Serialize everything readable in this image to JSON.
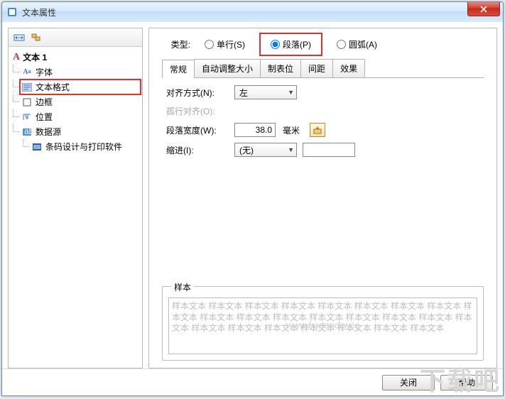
{
  "window": {
    "title": "文本属性"
  },
  "tree": {
    "root": "文本 1",
    "items": [
      {
        "icon": "font-icon",
        "label": "字体"
      },
      {
        "icon": "format-icon",
        "label": "文本格式",
        "highlight": true
      },
      {
        "icon": "border-icon",
        "label": "边框"
      },
      {
        "icon": "position-icon",
        "label": "位置"
      },
      {
        "icon": "datasource-icon",
        "label": "数据源"
      }
    ],
    "subitem": "条码设计与打印软件"
  },
  "type": {
    "label": "类型:",
    "options": [
      {
        "label": "单行(S)",
        "checked": false
      },
      {
        "label": "段落(P)",
        "checked": true,
        "highlight": true
      },
      {
        "label": "圆弧(A)",
        "checked": false
      }
    ]
  },
  "tabs": [
    "常规",
    "自动调整大小",
    "制表位",
    "间距",
    "效果"
  ],
  "active_tab": 0,
  "form": {
    "align_label": "对齐方式(N):",
    "align_value": "左",
    "orphan_label": "孤行对齐(O):",
    "width_label": "段落宽度(W):",
    "width_value": "38.0",
    "width_unit": "毫米",
    "indent_label": "缩进(I):",
    "indent_value": "(无)"
  },
  "sample": {
    "title": "样本",
    "text": "样本文本 样本文本 样本文本 样本文本 样本文本 样本文本 样本文本 样本文本 样本文本 样本文本 样本文本 样本文本 样本文本 样本文本 样本文本 样本文本 样本文本 样本文本 样本文本 样本文本 样本文本 样本文本 样本文本 样本文本",
    "watermark": "www.bartender.cc"
  },
  "footer": {
    "close": "关闭",
    "help": "帮助"
  },
  "corner_wm": "下载吧"
}
